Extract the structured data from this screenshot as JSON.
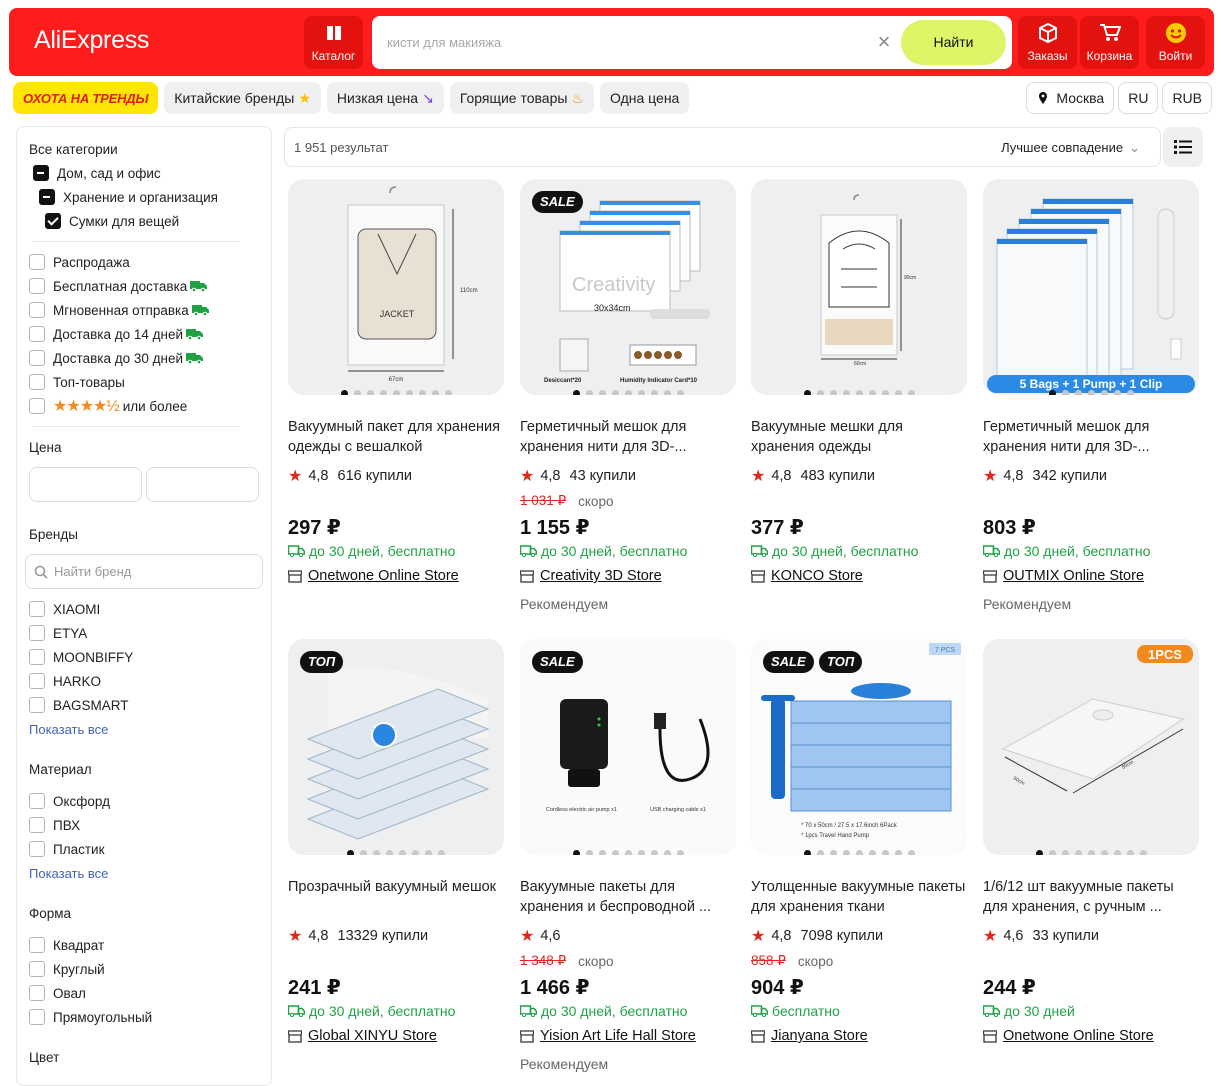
{
  "header": {
    "logo": "AliExpress",
    "catalog_label": "Каталог",
    "search_placeholder": "кисти для макияжа",
    "search_button": "Найти",
    "orders_label": "Заказы",
    "cart_label": "Корзина",
    "login_label": "Войти"
  },
  "chips": {
    "trend": "ОХОТА НА ТРЕНДЫ",
    "items": [
      "Китайские бренды",
      "Низкая цена",
      "Горящие товары",
      "Одна цена"
    ],
    "location": "Москва",
    "lang": "RU",
    "currency": "RUB"
  },
  "sidebar": {
    "all_categories": "Все категории",
    "cat_tree": [
      "Дом, сад и офис",
      "Хранение и организация",
      "Сумки для вещей"
    ],
    "filters": [
      "Распродажа",
      "Бесплатная доставка",
      "Мгновенная отправка",
      "Доставка до 14 дней",
      "Доставка до 30 дней",
      "Топ-товары"
    ],
    "rating_filter": "или более",
    "price_title": "Цена",
    "brands_title": "Бренды",
    "brand_search_placeholder": "Найти бренд",
    "brands": [
      "XIAOMI",
      "ETYA",
      "MOONBIFFY",
      "HARKO",
      "BAGSMART"
    ],
    "show_all": "Показать все",
    "material_title": "Материал",
    "materials": [
      "Оксфорд",
      "ПВХ",
      "Пластик"
    ],
    "shape_title": "Форма",
    "shapes": [
      "Квадрат",
      "Круглый",
      "Овал",
      "Прямоугольный"
    ],
    "color_title": "Цвет"
  },
  "results": {
    "count": "1 951 результат",
    "sort": "Лучшее совпадение"
  },
  "products": [
    {
      "title": "Вакуумный пакет для хранения одежды с вешалкой",
      "rating": "4,8",
      "sold": "616 купили",
      "old_price": "",
      "soon": "",
      "price": "297 ₽",
      "delivery": "до 30 дней, бесплатно",
      "store": "Onetwone Online Store",
      "rec": "",
      "badges": []
    },
    {
      "title": "Герметичный мешок для хранения нити для 3D-...",
      "rating": "4,8",
      "sold": "43 купили",
      "old_price": "1 031 ₽",
      "soon": "скоро",
      "price": "1 155 ₽",
      "delivery": "до 30 дней, бесплатно",
      "store": "Creativity 3D Store",
      "rec": "Рекомендуем",
      "badges": [
        "SALE"
      ]
    },
    {
      "title": "Вакуумные мешки для хранения одежды",
      "rating": "4,8",
      "sold": "483 купили",
      "old_price": "",
      "soon": "",
      "price": "377 ₽",
      "delivery": "до 30 дней, бесплатно",
      "store": "KONCO Store",
      "rec": "",
      "badges": []
    },
    {
      "title": "Герметичный мешок для хранения нити для 3D-...",
      "rating": "4,8",
      "sold": "342 купили",
      "old_price": "",
      "soon": "",
      "price": "803 ₽",
      "delivery": "до 30 дней, бесплатно",
      "store": "OUTMIX Online Store",
      "rec": "Рекомендуем",
      "badges": []
    },
    {
      "title": "Прозрачный вакуумный мешок",
      "rating": "4,8",
      "sold": "13329 купили",
      "old_price": "",
      "soon": "",
      "price": "241 ₽",
      "delivery": "до 30 дней, бесплатно",
      "store": "Global XINYU Store",
      "rec": "",
      "badges": [
        "ТОП"
      ]
    },
    {
      "title": "Вакуумные пакеты для хранения и беспроводной ...",
      "rating": "4,6",
      "sold": "",
      "old_price": "1 348 ₽",
      "soon": "скоро",
      "price": "1 466 ₽",
      "delivery": "до 30 дней, бесплатно",
      "store": "Yision Art Life Hall Store",
      "rec": "Рекомендуем",
      "badges": [
        "SALE"
      ]
    },
    {
      "title": "Утолщенные вакуумные пакеты для хранения ткани",
      "rating": "4,8",
      "sold": "7098 купили",
      "old_price": "858 ₽",
      "soon": "скоро",
      "price": "904 ₽",
      "delivery": "бесплатно",
      "store": "Jianyana Store",
      "rec": "",
      "badges": [
        "SALE",
        "ТОП"
      ]
    },
    {
      "title": "1/6/12 шт вакуумные пакеты для хранения, с ручным ...",
      "rating": "4,6",
      "sold": "33 купили",
      "old_price": "",
      "soon": "",
      "price": "244 ₽",
      "delivery": "до 30 дней",
      "store": "Onetwone Online Store",
      "rec": "",
      "badges": []
    }
  ],
  "image_text": {
    "p1_len": "110cm",
    "p1_w": "67cm",
    "p1_label": "JACKET",
    "p2_brand": "Creativity",
    "p2_size": "30x34cm",
    "p2_desiccant": "Desiccant*20",
    "p2_card": "Humidity Indicator Card*10",
    "p3_h": "90cm",
    "p3_w": "60cm",
    "p4_banner": "5 Bags + 1 Pump + 1 Clip",
    "p6_cap1": "Cordless electric air pump x1",
    "p6_cap2": "USB charging cable x1",
    "p7_tag": "7 PCS",
    "p7_note1": "* 70 x 50cm / 27.5 x 17.6inch  6Pack",
    "p7_note2": "* 1pcs Travel Hand Pump",
    "p8_tag": "1PCS",
    "p8_w": "60cm",
    "p8_l": "80cm"
  },
  "colors": {
    "header_red": "#ff1c1c",
    "find_btn": "#ddf567",
    "delivery_green": "#1fa246",
    "old_price_red": "#e0261d",
    "trend_yellow": "#ffe607"
  }
}
